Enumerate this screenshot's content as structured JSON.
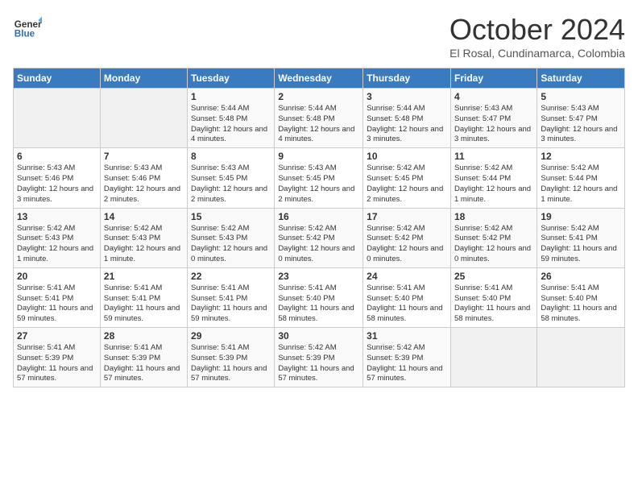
{
  "logo": {
    "line1": "General",
    "line2": "Blue"
  },
  "title": "October 2024",
  "subtitle": "El Rosal, Cundinamarca, Colombia",
  "days_of_week": [
    "Sunday",
    "Monday",
    "Tuesday",
    "Wednesday",
    "Thursday",
    "Friday",
    "Saturday"
  ],
  "weeks": [
    [
      {
        "day": "",
        "info": ""
      },
      {
        "day": "",
        "info": ""
      },
      {
        "day": "1",
        "info": "Sunrise: 5:44 AM\nSunset: 5:48 PM\nDaylight: 12 hours and 4 minutes."
      },
      {
        "day": "2",
        "info": "Sunrise: 5:44 AM\nSunset: 5:48 PM\nDaylight: 12 hours and 4 minutes."
      },
      {
        "day": "3",
        "info": "Sunrise: 5:44 AM\nSunset: 5:48 PM\nDaylight: 12 hours and 3 minutes."
      },
      {
        "day": "4",
        "info": "Sunrise: 5:43 AM\nSunset: 5:47 PM\nDaylight: 12 hours and 3 minutes."
      },
      {
        "day": "5",
        "info": "Sunrise: 5:43 AM\nSunset: 5:47 PM\nDaylight: 12 hours and 3 minutes."
      }
    ],
    [
      {
        "day": "6",
        "info": "Sunrise: 5:43 AM\nSunset: 5:46 PM\nDaylight: 12 hours and 3 minutes."
      },
      {
        "day": "7",
        "info": "Sunrise: 5:43 AM\nSunset: 5:46 PM\nDaylight: 12 hours and 2 minutes."
      },
      {
        "day": "8",
        "info": "Sunrise: 5:43 AM\nSunset: 5:45 PM\nDaylight: 12 hours and 2 minutes."
      },
      {
        "day": "9",
        "info": "Sunrise: 5:43 AM\nSunset: 5:45 PM\nDaylight: 12 hours and 2 minutes."
      },
      {
        "day": "10",
        "info": "Sunrise: 5:42 AM\nSunset: 5:45 PM\nDaylight: 12 hours and 2 minutes."
      },
      {
        "day": "11",
        "info": "Sunrise: 5:42 AM\nSunset: 5:44 PM\nDaylight: 12 hours and 1 minute."
      },
      {
        "day": "12",
        "info": "Sunrise: 5:42 AM\nSunset: 5:44 PM\nDaylight: 12 hours and 1 minute."
      }
    ],
    [
      {
        "day": "13",
        "info": "Sunrise: 5:42 AM\nSunset: 5:43 PM\nDaylight: 12 hours and 1 minute."
      },
      {
        "day": "14",
        "info": "Sunrise: 5:42 AM\nSunset: 5:43 PM\nDaylight: 12 hours and 1 minute."
      },
      {
        "day": "15",
        "info": "Sunrise: 5:42 AM\nSunset: 5:43 PM\nDaylight: 12 hours and 0 minutes."
      },
      {
        "day": "16",
        "info": "Sunrise: 5:42 AM\nSunset: 5:42 PM\nDaylight: 12 hours and 0 minutes."
      },
      {
        "day": "17",
        "info": "Sunrise: 5:42 AM\nSunset: 5:42 PM\nDaylight: 12 hours and 0 minutes."
      },
      {
        "day": "18",
        "info": "Sunrise: 5:42 AM\nSunset: 5:42 PM\nDaylight: 12 hours and 0 minutes."
      },
      {
        "day": "19",
        "info": "Sunrise: 5:42 AM\nSunset: 5:41 PM\nDaylight: 11 hours and 59 minutes."
      }
    ],
    [
      {
        "day": "20",
        "info": "Sunrise: 5:41 AM\nSunset: 5:41 PM\nDaylight: 11 hours and 59 minutes."
      },
      {
        "day": "21",
        "info": "Sunrise: 5:41 AM\nSunset: 5:41 PM\nDaylight: 11 hours and 59 minutes."
      },
      {
        "day": "22",
        "info": "Sunrise: 5:41 AM\nSunset: 5:41 PM\nDaylight: 11 hours and 59 minutes."
      },
      {
        "day": "23",
        "info": "Sunrise: 5:41 AM\nSunset: 5:40 PM\nDaylight: 11 hours and 58 minutes."
      },
      {
        "day": "24",
        "info": "Sunrise: 5:41 AM\nSunset: 5:40 PM\nDaylight: 11 hours and 58 minutes."
      },
      {
        "day": "25",
        "info": "Sunrise: 5:41 AM\nSunset: 5:40 PM\nDaylight: 11 hours and 58 minutes."
      },
      {
        "day": "26",
        "info": "Sunrise: 5:41 AM\nSunset: 5:40 PM\nDaylight: 11 hours and 58 minutes."
      }
    ],
    [
      {
        "day": "27",
        "info": "Sunrise: 5:41 AM\nSunset: 5:39 PM\nDaylight: 11 hours and 57 minutes."
      },
      {
        "day": "28",
        "info": "Sunrise: 5:41 AM\nSunset: 5:39 PM\nDaylight: 11 hours and 57 minutes."
      },
      {
        "day": "29",
        "info": "Sunrise: 5:41 AM\nSunset: 5:39 PM\nDaylight: 11 hours and 57 minutes."
      },
      {
        "day": "30",
        "info": "Sunrise: 5:42 AM\nSunset: 5:39 PM\nDaylight: 11 hours and 57 minutes."
      },
      {
        "day": "31",
        "info": "Sunrise: 5:42 AM\nSunset: 5:39 PM\nDaylight: 11 hours and 57 minutes."
      },
      {
        "day": "",
        "info": ""
      },
      {
        "day": "",
        "info": ""
      }
    ]
  ]
}
